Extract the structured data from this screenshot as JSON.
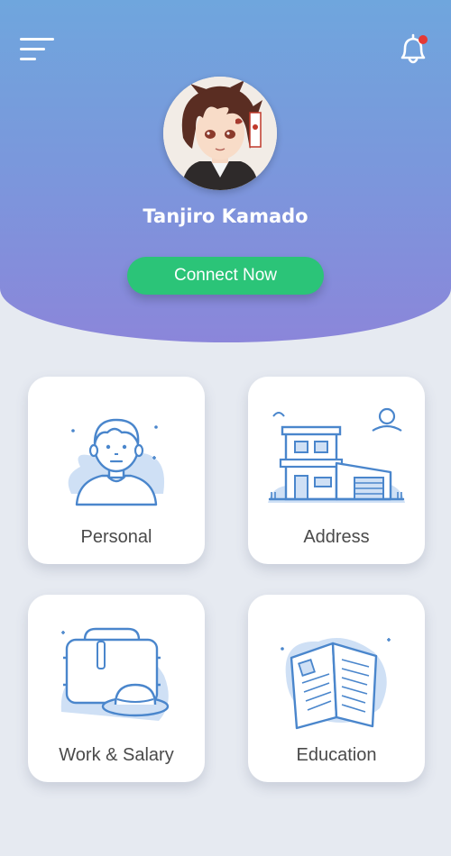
{
  "header": {
    "menu_icon": "hamburger-menu-icon",
    "notification_icon": "bell-icon",
    "notification_dot_color": "#e53935",
    "profile": {
      "name": "Tanjiro Kamado",
      "avatar_icon": "anime-character-avatar"
    },
    "connect_button": "Connect Now"
  },
  "colors": {
    "header_gradient_top": "#6fa6dd",
    "header_gradient_bottom": "#8b86da",
    "connect_button": "#2bc478",
    "background": "#e6eaf1",
    "icon_stroke": "#4a86cc",
    "icon_fill": "#cfe0f5"
  },
  "cards": [
    {
      "label": "Personal",
      "icon": "person-icon"
    },
    {
      "label": "Address",
      "icon": "house-icon"
    },
    {
      "label": "Work & Salary",
      "icon": "briefcase-icon"
    },
    {
      "label": "Education",
      "icon": "open-book-icon"
    }
  ]
}
